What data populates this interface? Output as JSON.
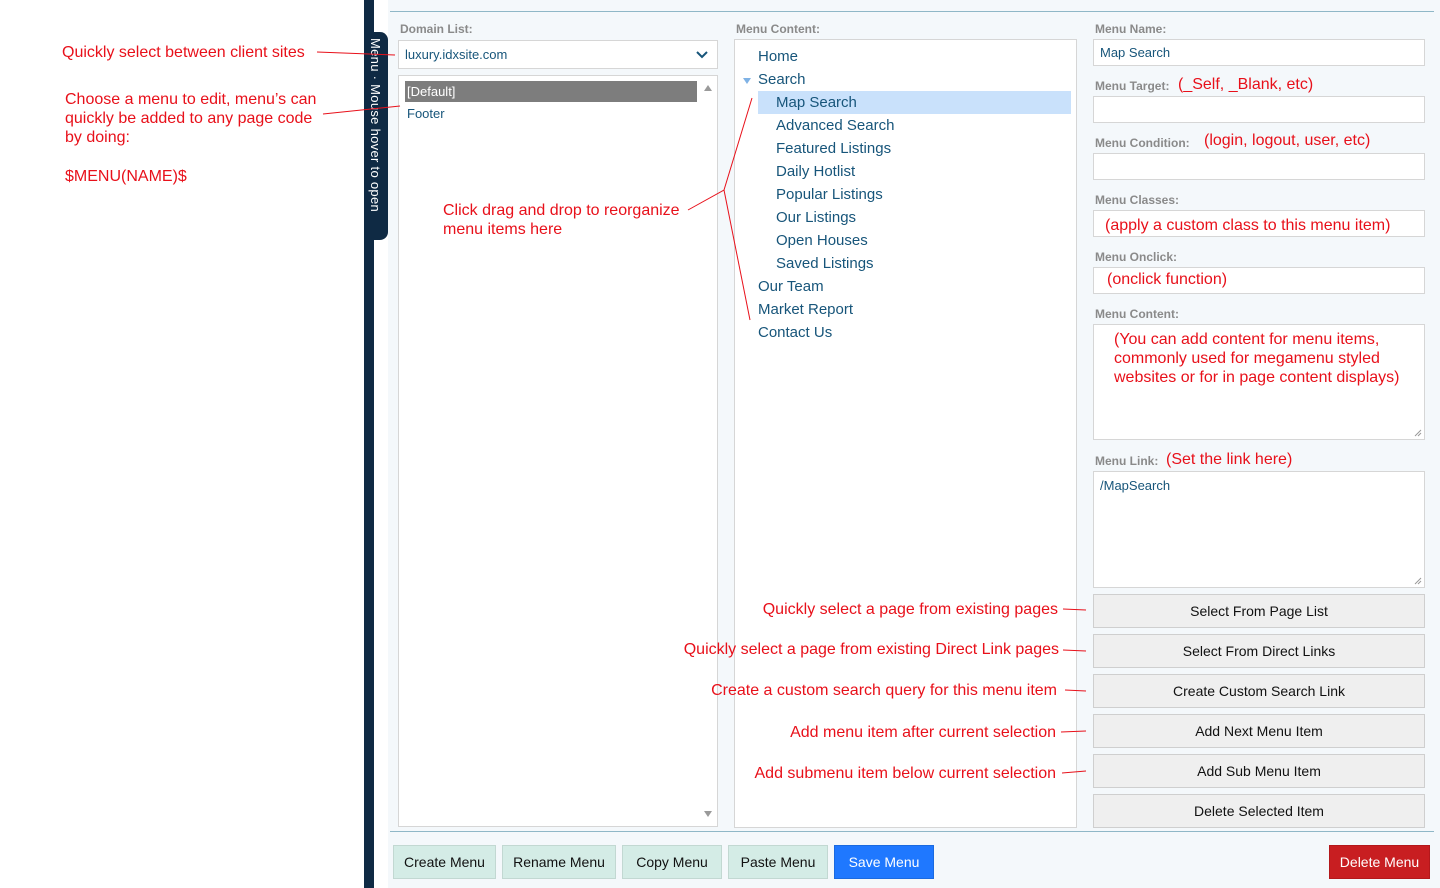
{
  "sidebar": {
    "tab_text": "Menu · Mouse hover to open"
  },
  "annotations": {
    "client_sites": "Quickly select between client sites",
    "choose_menu": [
      "Choose a menu to edit, menu’s can",
      "quickly be added to any page code",
      "by doing:"
    ],
    "menu_code": "$MENU(NAME)$",
    "drag_drop": [
      "Click drag and drop to reorganize",
      "menu items here"
    ],
    "menu_target_hint": "(_Self, _Blank, etc)",
    "menu_condition_hint": "(login, logout, user, etc)",
    "menu_classes_hint": "(apply a custom class to this menu item)",
    "menu_onclick_hint": "(onclick function)",
    "menu_content_hint": [
      "(You can add content for menu items,",
      "commonly used for megamenu styled",
      "websites or for in page content displays)"
    ],
    "menu_link_hint": "(Set the link here)",
    "page_list_hint": "Quickly select a page from existing pages",
    "direct_links_hint": "Quickly select a page from existing Direct Link pages",
    "custom_search_hint": "Create a custom search query for this menu item",
    "next_item_hint": "Add menu item after current selection",
    "sub_item_hint": "Add submenu item below current selection"
  },
  "domain": {
    "label": "Domain List:",
    "selected": "luxury.idxsite.com"
  },
  "menu_list": {
    "items": [
      {
        "label": "[Default]",
        "selected": true
      },
      {
        "label": "Footer",
        "selected": false
      }
    ]
  },
  "menu_content": {
    "label": "Menu Content:",
    "tree": [
      {
        "label": "Home",
        "level": 0
      },
      {
        "label": "Search",
        "level": 0,
        "expanded": true
      },
      {
        "label": "Map Search",
        "level": 1,
        "selected": true
      },
      {
        "label": "Advanced Search",
        "level": 1
      },
      {
        "label": "Featured Listings",
        "level": 1
      },
      {
        "label": "Daily Hotlist",
        "level": 1
      },
      {
        "label": "Popular Listings",
        "level": 1
      },
      {
        "label": "Our Listings",
        "level": 1
      },
      {
        "label": "Open Houses",
        "level": 1
      },
      {
        "label": "Saved Listings",
        "level": 1
      },
      {
        "label": "Our Team",
        "level": 0
      },
      {
        "label": "Market Report",
        "level": 0
      },
      {
        "label": "Contact Us",
        "level": 0
      }
    ]
  },
  "form": {
    "name_label": "Menu Name:",
    "name_value": "Map Search",
    "target_label": "Menu Target:",
    "condition_label": "Menu Condition:",
    "classes_label": "Menu Classes:",
    "onclick_label": "Menu Onclick:",
    "content_label": "Menu Content:",
    "link_label": "Menu Link:",
    "link_value": "/MapSearch"
  },
  "actions": {
    "select_page_list": "Select From Page List",
    "select_direct_links": "Select From Direct Links",
    "create_custom_search": "Create Custom Search Link",
    "add_next": "Add Next Menu Item",
    "add_sub": "Add Sub Menu Item",
    "delete_selected": "Delete Selected Item"
  },
  "bottom": {
    "create": "Create Menu",
    "rename": "Rename Menu",
    "copy": "Copy Menu",
    "paste": "Paste Menu",
    "save": "Save Menu",
    "delete": "Delete Menu"
  },
  "colors": {
    "annotation": "#e8101a",
    "sidebar": "#0f2a44",
    "save": "#1f78ff",
    "delete": "#c81e21",
    "selection": "#c9e1fb"
  }
}
